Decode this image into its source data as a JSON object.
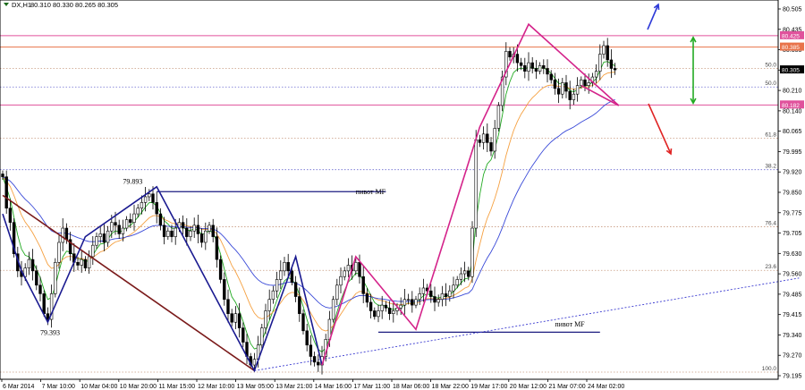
{
  "header": {
    "symbol_label": "DX,H1",
    "ohlc_label": "80.310 80.330 80.265 80.305"
  },
  "chart_data": {
    "type": "candlestick",
    "symbol": "DX",
    "timeframe": "H1",
    "ohlc": {
      "open": 80.31,
      "high": 80.33,
      "low": 80.265,
      "close": 80.305
    },
    "ylim": [
      79.22,
      80.55
    ],
    "y_ticks": [
      "80.505",
      "80.435",
      "80.355",
      "80.285",
      "80.210",
      "80.140",
      "80.065",
      "79.995",
      "79.920",
      "79.850",
      "79.775",
      "79.705",
      "79.630",
      "79.560",
      "79.485",
      "79.415",
      "79.340",
      "79.270",
      "79.195"
    ],
    "x_ticks": [
      "6 Mar 2014",
      "7 Mar 10:00",
      "10 Mar 04:00",
      "10 Mar 20:00",
      "11 Mar 15:00",
      "12 Mar 10:00",
      "13 Mar 05:00",
      "13 Mar 21:00",
      "14 Mar 16:00",
      "17 Mar 11:00",
      "18 Mar 06:00",
      "18 Mar 22:00",
      "19 Mar 17:00",
      "20 Mar 12:00",
      "21 Mar 07:00",
      "24 Mar 02:00"
    ],
    "price_tags": [
      {
        "value": 80.425,
        "label": "80.425",
        "color": "#e0529c"
      },
      {
        "value": 80.385,
        "label": "80.385",
        "color": "#e8734a"
      },
      {
        "value": 80.305,
        "label": "80.305",
        "color": "#000000"
      },
      {
        "value": 80.182,
        "label": "80.182",
        "color": "#e0529c"
      }
    ],
    "fibo_levels": [
      {
        "label": "50.0",
        "value": 80.31
      },
      {
        "label": "50.0",
        "value": 80.245
      },
      {
        "label": "61.8",
        "value": 80.065
      },
      {
        "label": "38.2",
        "value": 79.955
      },
      {
        "label": "76.4",
        "value": 79.755
      },
      {
        "label": "23.6",
        "value": 79.602
      },
      {
        "label": "100.0",
        "value": 79.245
      }
    ],
    "horizontal_lines": [
      {
        "value": 80.425,
        "color": "#e0529c"
      },
      {
        "value": 80.385,
        "color": "#e8734a"
      },
      {
        "value": 80.182,
        "color": "#e0529c"
      }
    ],
    "annotations": [
      {
        "text": "79.893",
        "x": 32,
        "y": 79.905
      },
      {
        "text": "79.393",
        "x": 10,
        "y": 79.375
      },
      {
        "text": "пивот MF",
        "x": 94,
        "y": 79.87
      },
      {
        "text": "пивот MF",
        "x": 147,
        "y": 79.405
      }
    ],
    "pivot_lines": [
      {
        "label": "пивот MF",
        "from": 41,
        "to": 102,
        "value": 79.878
      },
      {
        "label": "пивот MF",
        "from": 100,
        "to": 159,
        "value": 79.385
      }
    ],
    "patterns": {
      "navy": [
        [
          0,
          79.8
        ],
        [
          5,
          79.6
        ],
        [
          12,
          79.42
        ],
        [
          22,
          79.72
        ],
        [
          41,
          79.895
        ],
        [
          67,
          79.25
        ],
        [
          78,
          79.65
        ],
        [
          85,
          79.27
        ]
      ],
      "magenta": [
        [
          85,
          79.27
        ],
        [
          94,
          79.65
        ],
        [
          110,
          79.395
        ],
        [
          127,
          80.105
        ],
        [
          140,
          80.465
        ],
        [
          164,
          80.18
        ],
        [
          154,
          80.25
        ]
      ],
      "diagonal": [
        [
          0,
          79.865
        ],
        [
          67,
          79.25
        ]
      ]
    },
    "trendline": {
      "from": [
        67,
        79.25
      ],
      "to": [
        212,
        79.575
      ]
    },
    "arrows": [
      {
        "color": "#2f3bd8",
        "direction": "up"
      },
      {
        "color": "#e02424",
        "direction": "down"
      },
      {
        "color": "#22aa22",
        "direction": "both"
      }
    ],
    "series": [
      {
        "type": "candles",
        "closes": [
          79.93,
          79.82,
          79.77,
          79.66,
          79.6,
          79.58,
          79.61,
          79.64,
          79.6,
          79.55,
          79.52,
          79.45,
          79.43,
          79.52,
          79.63,
          79.7,
          79.75,
          79.71,
          79.66,
          79.63,
          79.62,
          79.64,
          79.61,
          79.65,
          79.69,
          79.72,
          79.73,
          79.7,
          79.74,
          79.77,
          79.76,
          79.73,
          79.75,
          79.78,
          79.77,
          79.8,
          79.82,
          79.84,
          79.86,
          79.87,
          79.84,
          79.8,
          79.76,
          79.72,
          79.74,
          79.72,
          79.75,
          79.77,
          79.75,
          79.72,
          79.74,
          79.76,
          79.73,
          79.7,
          79.74,
          79.76,
          79.72,
          79.64,
          79.57,
          79.5,
          79.45,
          79.42,
          79.45,
          79.4,
          79.35,
          79.3,
          79.27,
          79.29,
          79.34,
          79.4,
          79.46,
          79.5,
          79.53,
          79.57,
          79.6,
          79.63,
          79.6,
          79.56,
          79.51,
          79.45,
          79.39,
          79.34,
          79.3,
          79.28,
          79.27,
          79.3,
          79.36,
          79.43,
          79.5,
          79.55,
          79.58,
          79.6,
          79.62,
          79.6,
          79.63,
          79.58,
          79.52,
          79.49,
          79.46,
          79.44,
          79.46,
          79.48,
          79.47,
          79.45,
          79.46,
          79.47,
          79.48,
          79.5,
          79.5,
          79.48,
          79.5,
          79.52,
          79.54,
          79.53,
          79.51,
          79.49,
          79.5,
          79.52,
          79.51,
          79.53,
          79.55,
          79.57,
          79.59,
          79.6,
          79.58,
          79.75,
          80.06,
          80.05,
          80.08,
          80.05,
          80.02,
          80.1,
          80.18,
          80.28,
          80.37,
          80.35,
          80.36,
          80.33,
          80.32,
          80.3,
          80.33,
          80.31,
          80.3,
          80.32,
          80.31,
          80.29,
          80.27,
          80.24,
          80.22,
          80.26,
          80.23,
          80.2,
          80.22,
          80.25,
          80.27,
          80.25,
          80.26,
          80.28,
          80.3,
          80.36,
          80.39,
          80.34,
          80.31,
          80.305
        ]
      },
      {
        "type": "moving-average",
        "period": "fast",
        "color": "#22aa22"
      },
      {
        "type": "moving-average",
        "period": "medium",
        "color": "#f5a040"
      },
      {
        "type": "moving-average",
        "period": "slow",
        "color": "#3a4ad8"
      }
    ]
  }
}
